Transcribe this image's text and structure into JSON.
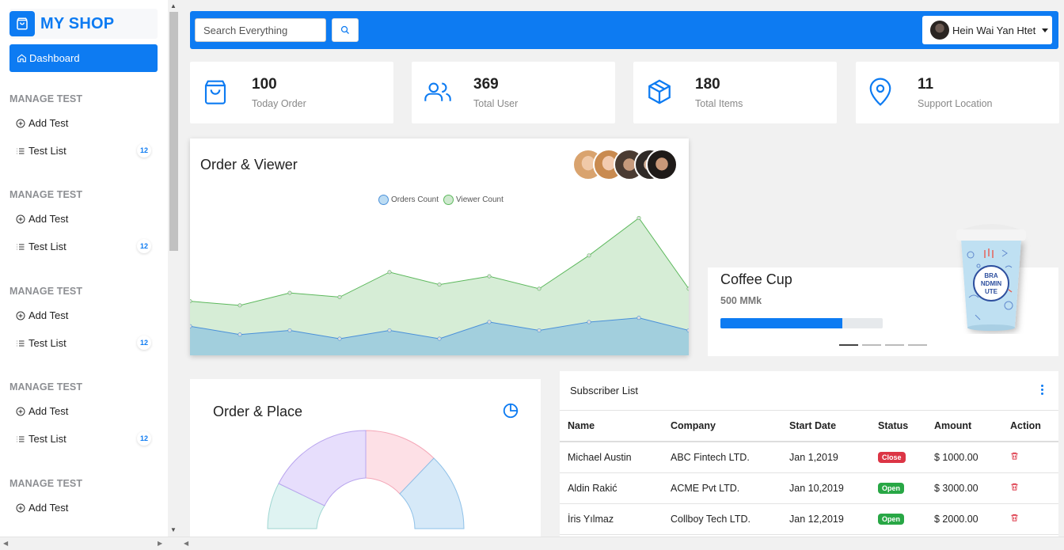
{
  "brand": {
    "name": "MY SHOP"
  },
  "sidebar": {
    "dashboard_label": "Dashboard",
    "sections": [
      {
        "title": "MANAGE TEST",
        "items": [
          {
            "label": "Add Test"
          },
          {
            "label": "Test List",
            "count": "12"
          }
        ]
      },
      {
        "title": "MANAGE TEST",
        "items": [
          {
            "label": "Add Test"
          },
          {
            "label": "Test List",
            "count": "12"
          }
        ]
      },
      {
        "title": "MANAGE TEST",
        "items": [
          {
            "label": "Add Test"
          },
          {
            "label": "Test List",
            "count": "12"
          }
        ]
      },
      {
        "title": "MANAGE TEST",
        "items": [
          {
            "label": "Add Test"
          },
          {
            "label": "Test List",
            "count": "12"
          }
        ]
      },
      {
        "title": "MANAGE TEST",
        "items": [
          {
            "label": "Add Test"
          }
        ]
      }
    ]
  },
  "topbar": {
    "search_placeholder": "Search Everything",
    "user_name": "Hein Wai Yan Htet"
  },
  "stats": [
    {
      "value": "100",
      "label": "Today Order",
      "icon": "bag-icon"
    },
    {
      "value": "369",
      "label": "Total User",
      "icon": "users-icon"
    },
    {
      "value": "180",
      "label": "Total Items",
      "icon": "box-icon"
    },
    {
      "value": "11",
      "label": "Support Location",
      "icon": "location-pin-icon"
    }
  ],
  "order_viewer": {
    "title": "Order & Viewer",
    "legend": [
      "Orders Count",
      "Viewer Count"
    ]
  },
  "chart_data": {
    "type": "area",
    "series": [
      {
        "name": "Orders Count",
        "values": [
          7,
          5,
          6,
          4,
          6,
          4,
          8,
          6,
          8,
          9,
          6
        ],
        "color": "#4a90d9"
      },
      {
        "name": "Viewer Count",
        "values": [
          13,
          12,
          15,
          14,
          20,
          17,
          19,
          16,
          24,
          33,
          16
        ],
        "color": "#5cb85c"
      }
    ],
    "ylim": [
      0,
      35
    ]
  },
  "coffee": {
    "title": "Coffee Cup",
    "price": "500 MMk",
    "progress": 0.75,
    "cup_text": [
      "BRA",
      "NDMIN",
      "UTE"
    ]
  },
  "order_place": {
    "title": "Order & Place"
  },
  "subscribers": {
    "title": "Subscriber List",
    "columns": [
      "Name",
      "Company",
      "Start Date",
      "Status",
      "Amount",
      "Action"
    ],
    "rows": [
      {
        "name": "Michael Austin",
        "company": "ABC Fintech LTD.",
        "start": "Jan 1,2019",
        "status": "Close",
        "status_color": "#dc3545",
        "amount": "$ 1000.00"
      },
      {
        "name": "Aldin Rakić",
        "company": "ACME Pvt LTD.",
        "start": "Jan 10,2019",
        "status": "Open",
        "status_color": "#28a745",
        "amount": "$ 3000.00"
      },
      {
        "name": "İris Yılmaz",
        "company": "Collboy Tech LTD.",
        "start": "Jan 12,2019",
        "status": "Open",
        "status_color": "#28a745",
        "amount": "$ 2000.00"
      }
    ]
  },
  "colors": {
    "primary": "#0d7bf2",
    "background": "#f1f1f1"
  }
}
